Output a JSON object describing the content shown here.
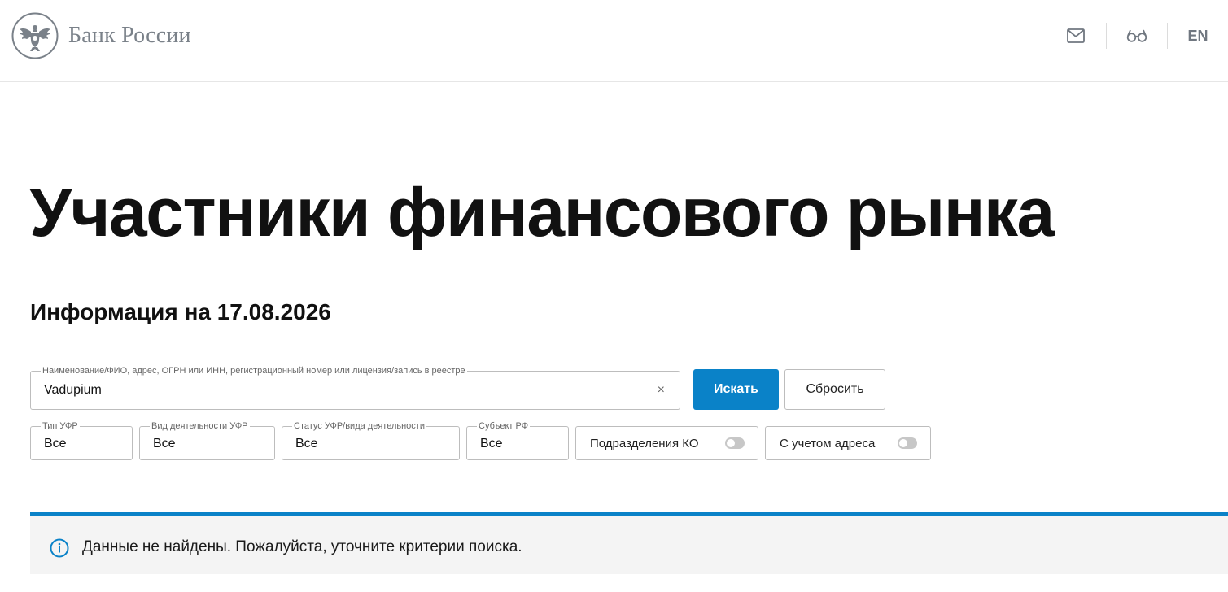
{
  "header": {
    "logo_text": "Банк России",
    "lang_label": "EN"
  },
  "page": {
    "title": "Участники финансового рынка",
    "subtitle": "Информация на 17.08.2026"
  },
  "search": {
    "legend": "Наименование/ФИО, адрес, ОГРН или ИНН, регистрационный номер или лицензия/запись в реестре",
    "value": "Vadupium",
    "clear_label": "×",
    "submit_label": "Искать",
    "reset_label": "Сбросить"
  },
  "filters": [
    {
      "legend": "Тип УФР",
      "value": "Все"
    },
    {
      "legend": "Вид деятельности УФР",
      "value": "Все"
    },
    {
      "legend": "Статус УФР/вида деятельности",
      "value": "Все"
    },
    {
      "legend": "Субъект РФ",
      "value": "Все"
    }
  ],
  "toggles": [
    {
      "label": "Подразделения КО",
      "on": false
    },
    {
      "label": "С учетом адреса",
      "on": false
    }
  ],
  "notice": {
    "text": "Данные не найдены. Пожалуйста, уточните критерии поиска."
  },
  "colors": {
    "accent": "#0a82c8",
    "logo_gray": "#7a8189",
    "notice_bg": "#f4f4f4"
  }
}
